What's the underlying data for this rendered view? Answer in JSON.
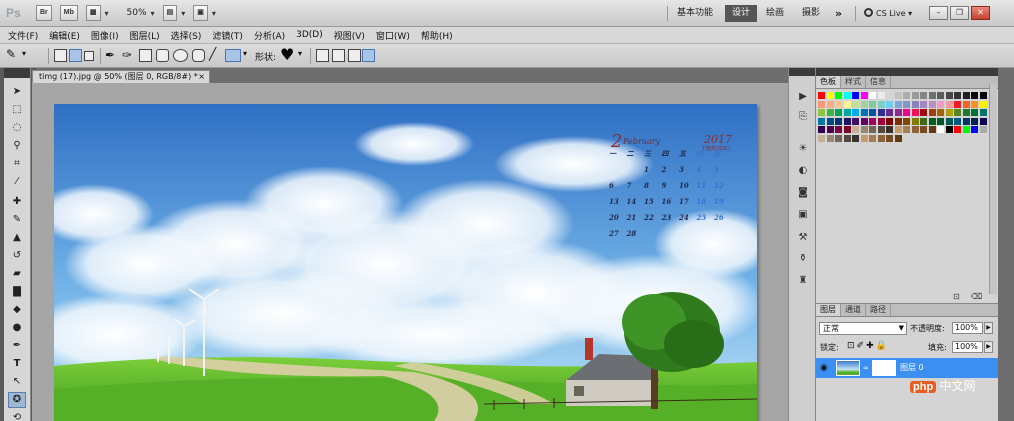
{
  "titlebar": {
    "app_logo": "Ps",
    "bridge_btn": "Br",
    "minibridge_btn": "Mb",
    "zoom": "50%",
    "workspaces": [
      "基本功能",
      "设计",
      "绘画",
      "摄影"
    ],
    "more": "»",
    "cslive": "CS Live",
    "win_controls": [
      "–",
      "❐",
      "✕"
    ]
  },
  "menu": [
    "文件(F)",
    "编辑(E)",
    "图像(I)",
    "图层(L)",
    "选择(S)",
    "滤镜(T)",
    "分析(A)",
    "3D(D)",
    "视图(V)",
    "窗口(W)",
    "帮助(H)"
  ],
  "options": {
    "shape_label": "形状:",
    "shape_icon": "heart"
  },
  "document": {
    "tab_title": "timg (17).jpg @ 50% (图层 0, RGB/8#) *",
    "close": "×",
    "calendar": {
      "month_num": "2",
      "month_name": "February",
      "year": "2017",
      "subtitle": "丁酉年[鸡年]",
      "weekdays": [
        "一",
        "二",
        "三",
        "四",
        "五",
        "六",
        "日"
      ],
      "rows": [
        [
          "",
          "",
          "1",
          "2",
          "3",
          "4",
          "5"
        ],
        [
          "6",
          "7",
          "8",
          "9",
          "10",
          "11",
          "12"
        ],
        [
          "13",
          "14",
          "15",
          "16",
          "17",
          "18",
          "19"
        ],
        [
          "20",
          "21",
          "22",
          "23",
          "24",
          "25",
          "26"
        ],
        [
          "27",
          "28",
          "",
          "",
          "",
          "",
          ""
        ]
      ]
    }
  },
  "swatches_panel": {
    "tabs": [
      "色板",
      "样式",
      "信息"
    ]
  },
  "layers_panel": {
    "tabs": [
      "图层",
      "通道",
      "路径"
    ],
    "blend_mode": "正常",
    "opacity_label": "不透明度:",
    "opacity_value": "100%",
    "lock_label": "锁定:",
    "fill_label": "填充:",
    "fill_value": "100%",
    "layer_name": "图层 0"
  },
  "watermark": {
    "badge": "php",
    "text": "中文网"
  }
}
